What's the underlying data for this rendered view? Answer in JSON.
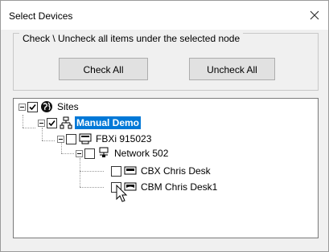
{
  "window": {
    "title": "Select Devices"
  },
  "group": {
    "legend": "Check \\ Uncheck all items under the selected node",
    "check_all": "Check All",
    "uncheck_all": "Uncheck All"
  },
  "tree": {
    "sites": {
      "label": "Sites",
      "checked": true,
      "expanded": true
    },
    "manual_demo": {
      "label": "Manual Demo",
      "checked": true,
      "selected": true
    },
    "fbxi": {
      "label": "FBXi 915023",
      "checked": false
    },
    "network": {
      "label": "Network 502",
      "checked": false
    },
    "cbx": {
      "label": "CBX Chris Desk",
      "checked": false
    },
    "cbm": {
      "label": "CBM Chris Desk1",
      "checked": false
    }
  },
  "icons": [
    "close-icon",
    "globe-icon",
    "network-tree-icon",
    "device-icon",
    "network-icon",
    "desk-phone-icon",
    "mouse-cursor-icon"
  ]
}
